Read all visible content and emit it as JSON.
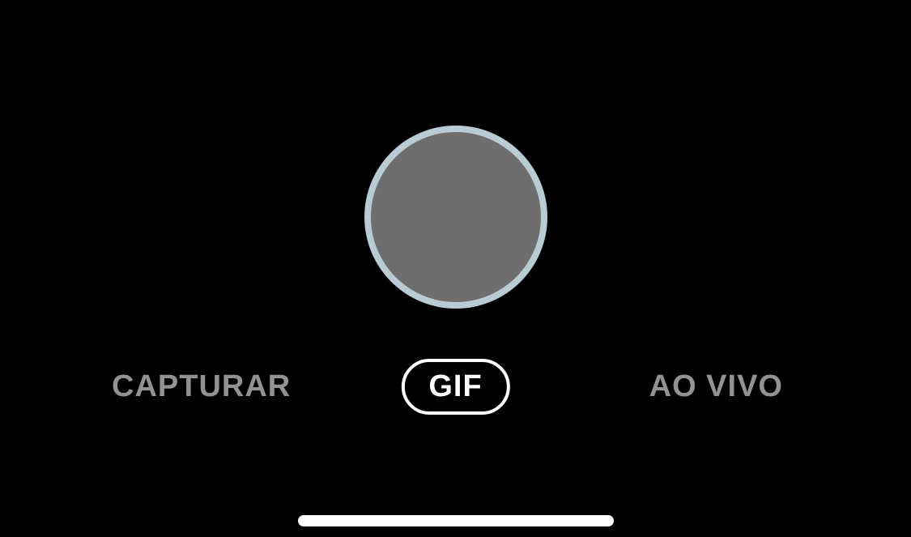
{
  "capture": {
    "ring_color": "#b9cbd5",
    "inner_color": "#6e6e6e"
  },
  "modes": {
    "left": "CAPTURAR",
    "center": "GIF",
    "right": "AO VIVO",
    "active": "center"
  }
}
